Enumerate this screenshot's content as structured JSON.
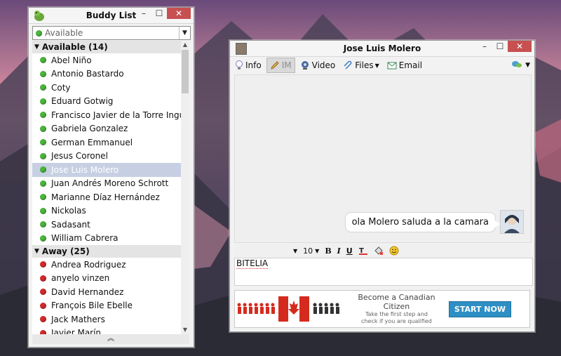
{
  "buddy_list": {
    "title": "Buddy List",
    "status_value": "Available",
    "groups": [
      {
        "label": "Available (14)",
        "status_color": "#49b83a",
        "buddies": [
          "Abel Niño",
          "Antonio Bastardo",
          "Coty",
          "Eduard Gotwig",
          "Francisco Javier de la Torre Ingu...",
          "Gabriela Gonzalez",
          "German Emmanuel",
          "Jesus Coronel",
          "Jose Luis Molero",
          "Juan Andrés Moreno Schrott",
          "Marianne Díaz Hernández",
          "Nickolas",
          "Sadasant",
          "William Cabrera"
        ],
        "selected_index": 8
      },
      {
        "label": "Away (25)",
        "status_color": "#d42a2a",
        "buddies": [
          "Andrea Rodriguez",
          "anyelo vinzen",
          "David Hernandez",
          "François Bile Ebelle",
          "Jack Mathers",
          "Javier Marín"
        ]
      }
    ],
    "bottom_icon": "double-chevron-up-icon"
  },
  "chat": {
    "title": "Jose Luis Molero",
    "toolbar": {
      "info": "Info",
      "im": "IM",
      "video": "Video",
      "files": "Files",
      "email": "Email"
    },
    "message": "ola Molero saluda a la camara",
    "font_size": "10",
    "input_text": "BITELIA",
    "ad": {
      "headline": "Become a Canadian Citizen",
      "sub1": "Take the first step and",
      "sub2": "check if you are qualified",
      "cta": "START NOW"
    }
  },
  "colors": {
    "available": "#49b83a",
    "away": "#d42a2a",
    "close_button": "#c75050",
    "selection": "#c7d0e3",
    "cta": "#2e8fc4"
  }
}
